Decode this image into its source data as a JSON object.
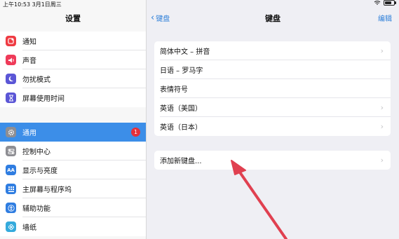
{
  "status": {
    "time": "上午10:53",
    "date": "3月1日周三"
  },
  "sidebar": {
    "title": "设置",
    "group1": [
      {
        "label": "通知",
        "icon": "notification-icon",
        "color": "#ef3b43"
      },
      {
        "label": "声音",
        "icon": "sound-icon",
        "color": "#ef3b59"
      },
      {
        "label": "勿扰模式",
        "icon": "moon-icon",
        "color": "#5b56d6"
      },
      {
        "label": "屏幕使用时间",
        "icon": "hourglass-icon",
        "color": "#5b56d6"
      }
    ],
    "group2": [
      {
        "label": "通用",
        "icon": "gear-icon",
        "color": "#8e8e93",
        "badge": "1",
        "active": true
      },
      {
        "label": "控制中心",
        "icon": "control-center-icon",
        "color": "#8e8e93"
      },
      {
        "label": "显示与亮度",
        "icon": "display-brightness-icon",
        "color": "#2f7de1"
      },
      {
        "label": "主屏幕与程序坞",
        "icon": "home-screen-icon",
        "color": "#2f7de1"
      },
      {
        "label": "辅助功能",
        "icon": "accessibility-icon",
        "color": "#2f7de1"
      },
      {
        "label": "墙纸",
        "icon": "wallpaper-icon",
        "color": "#34aadc"
      }
    ]
  },
  "nav": {
    "back_label": "键盘",
    "title": "键盘",
    "edit_label": "编辑"
  },
  "keyboards": [
    {
      "label": "简体中文 – 拼音",
      "chevron": true
    },
    {
      "label": "日语 – 罗马字",
      "chevron": false
    },
    {
      "label": "表情符号",
      "chevron": false
    },
    {
      "label": "英语（美国）",
      "chevron": true
    },
    {
      "label": "英语（日本）",
      "chevron": true
    }
  ],
  "add_keyboard": {
    "label": "添加新键盘...",
    "chevron": true
  },
  "colors": {
    "accent": "#2d7fd9",
    "active_row": "#3c8ee8",
    "annotation_arrow": "#e04050"
  }
}
